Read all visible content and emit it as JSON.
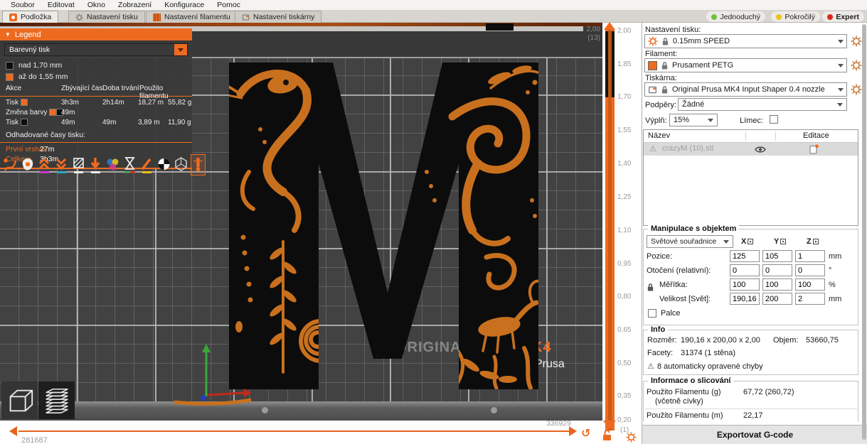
{
  "menu": {
    "items": [
      "Soubor",
      "Editovat",
      "Okno",
      "Zobrazení",
      "Konfigurace",
      "Pomoc"
    ]
  },
  "tabs": [
    {
      "label": "Podložka"
    },
    {
      "label": "Nastavení tisku"
    },
    {
      "label": "Nastavení filamentu"
    },
    {
      "label": "Nastavení tiskárny"
    }
  ],
  "modes": [
    {
      "label": "Jednoduchý",
      "color": "#72c03c"
    },
    {
      "label": "Pokročilý",
      "color": "#eec21b"
    },
    {
      "label": "Expert",
      "color": "#d8271a"
    }
  ],
  "legend": {
    "title": "Legend",
    "view_mode": "Barevný tisk",
    "ranges": [
      {
        "color": "#0d0d0d",
        "label": "nad 1,70 mm"
      },
      {
        "color": "#ED6B21",
        "label": "až do 1,55 mm"
      }
    ],
    "columns": [
      "Akce",
      "Zbývající čas",
      "Doba trvání",
      "Použito filamentu"
    ],
    "rows": [
      {
        "akce": "Tisk",
        "color1": "#ED6B21",
        "remaining": "3h3m",
        "duration": "2h14m",
        "used_m": "18,27 m",
        "used_g": "55,82 g"
      },
      {
        "akce": "Změna barvy",
        "color1": "#ED6B21",
        "color2": "#0d0d0d",
        "remaining": "49m",
        "duration": "",
        "used_m": "",
        "used_g": ""
      },
      {
        "akce": "Tisk",
        "color1": "#0d0d0d",
        "remaining": "49m",
        "duration": "49m",
        "used_m": "3,89 m",
        "used_g": "11,90 g"
      }
    ],
    "estimates_title": "Odhadované časy tisku:",
    "first_layer_label": "První vrstva:",
    "first_layer_value": "27m",
    "total_label": "Celkem:",
    "total_value": "3h3m"
  },
  "viewport": {
    "bed_text_left": "ORIGINA",
    "bed_text_right": "K4",
    "bed_signature": "Prusa"
  },
  "layer_slider": {
    "top_value": "2,00",
    "top_layer": "(13)",
    "ticks": [
      "2,00",
      "1,85",
      "1,70",
      "1,55",
      "1,40",
      "1,25",
      "1,10",
      "0,95",
      "0,80",
      "0,65",
      "0,50",
      "0,35",
      "0,20"
    ],
    "bottom_layer": "(1)"
  },
  "move_slider": {
    "left_label": "281687",
    "right_label": "336929"
  },
  "sidebar": {
    "print_settings": {
      "label": "Nastavení tisku:",
      "value": "0.15mm SPEED"
    },
    "filament": {
      "label": "Filament:",
      "value": "Prusament PETG",
      "color": "#ED6B21"
    },
    "printer": {
      "label": "Tiskárna:",
      "value": "Original Prusa MK4 Input Shaper 0.4 nozzle"
    },
    "supports": {
      "label": "Podpěry:",
      "value": "Žádné"
    },
    "infill": {
      "label": "Výplň:",
      "value": "15%"
    },
    "brim": {
      "label": "Límec:"
    },
    "objects": {
      "col_name": "Název",
      "col_edit": "Editace",
      "row_name": "crazyM (10).stl"
    },
    "manipulation": {
      "title": "Manipulace s objektem",
      "coord_system": "Světové souřadnice",
      "axes": [
        "X",
        "Y",
        "Z"
      ],
      "position": {
        "label": "Pozice:",
        "v0": "125",
        "v1": "105",
        "v2": "1",
        "unit": "mm"
      },
      "rotation": {
        "label": "Otočení (relativní):",
        "v0": "0",
        "v1": "0",
        "v2": "0",
        "unit": "°"
      },
      "scale": {
        "label": "Měřítka:",
        "v0": "100",
        "v1": "100",
        "v2": "100",
        "unit": "%"
      },
      "size": {
        "label": "Velikost [Svět]:",
        "v0": "190,16",
        "v1": "200",
        "v2": "2",
        "unit": "mm"
      },
      "inches_label": "Palce"
    },
    "info": {
      "title": "Info",
      "size_label": "Rozměr:",
      "size_value": "190,16 x 200,00 x 2,00",
      "volume_label": "Objem:",
      "volume_value": "53660,75",
      "facets_label": "Facety:",
      "facets_value": "31374 (1 stěna)",
      "warning": "8 automaticky opravené chyby"
    },
    "slicing": {
      "title": "Informace o slicování",
      "used_g_label": "Použito Filamentu (g)",
      "used_g_sub": "(včetně cívky)",
      "used_g_value": "67,72 (260,72)",
      "used_m_label": "Použito Filamentu (m)",
      "used_m_value": "22,17"
    },
    "export_button": "Exportovat G-code"
  },
  "colors": {
    "accent": "#ED6B21",
    "model_ink": "#0c0c0c",
    "ornament": "#c9701e"
  }
}
